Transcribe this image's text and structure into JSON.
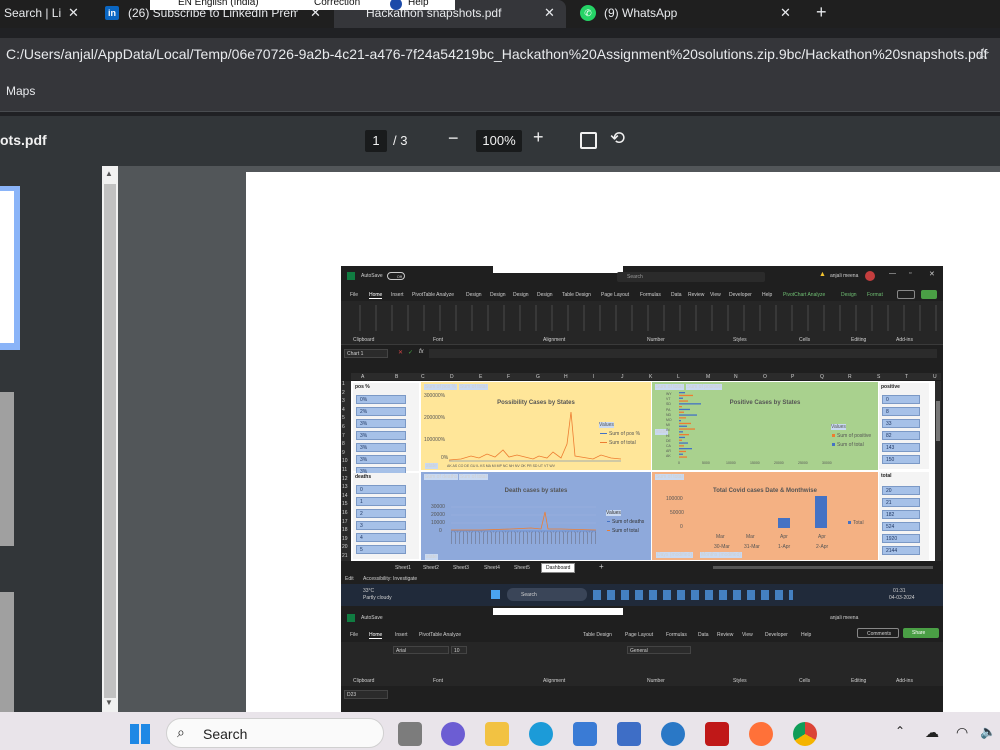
{
  "tabs": [
    {
      "label": "Search | Li",
      "active": false
    },
    {
      "label": "(26) Subscribe to LinkedIn Prem",
      "active": false
    },
    {
      "label": "Hackathon snapshots.pdf",
      "active": true
    },
    {
      "label": "(9) WhatsApp",
      "active": false
    }
  ],
  "lang_overlay": {
    "lang": "EN English (India)",
    "correction": "Correction",
    "help": "Help"
  },
  "address": {
    "url": "C:/Users/anjal/AppData/Local/Temp/06e70726-9a2b-4c21-a476-7f24a54219bc_Hackathon%20Assignment%20solutions.zip.9bc/Hackathon%20snapshots.pdf"
  },
  "bookmarks": {
    "item": "Maps"
  },
  "pdf": {
    "filename": "ots.pdf",
    "page": "1",
    "total": "/ 3",
    "zoom": "100%"
  },
  "excel": {
    "autosave": "AutoSave",
    "autosave_state": "Off",
    "search": "Search",
    "user": "anjali meena",
    "ribbon_tabs": [
      "File",
      "Home",
      "Insert",
      "PivotTable Analyze",
      "Design",
      "Design",
      "Design",
      "Design",
      "Table Design",
      "Page Layout",
      "Formulas",
      "Data",
      "Review",
      "View",
      "Developer",
      "Help",
      "PivotChart Analyze",
      "Design",
      "Format"
    ],
    "ribbon_groups": [
      "Clipboard",
      "Font",
      "Alignment",
      "Number",
      "Styles",
      "Cells",
      "Editing",
      "Add-ins"
    ],
    "name_box": "Chart 1",
    "columns": [
      "A",
      "B",
      "C",
      "D",
      "E",
      "F",
      "G",
      "H",
      "I",
      "J",
      "K",
      "L",
      "M",
      "N",
      "O",
      "P",
      "Q",
      "R",
      "S",
      "T",
      "U"
    ],
    "rows": [
      "1",
      "2",
      "3",
      "4",
      "5",
      "6",
      "7",
      "8",
      "9",
      "10",
      "11",
      "12",
      "13",
      "14",
      "15",
      "16",
      "17",
      "18",
      "19",
      "20",
      "21"
    ],
    "slicers": {
      "pos": {
        "title": "pos %",
        "items": [
          "0%",
          "2%",
          "3%",
          "3%",
          "3%",
          "3%",
          "3%"
        ]
      },
      "deaths": {
        "title": "deaths",
        "items": [
          "0",
          "1",
          "2",
          "3",
          "4",
          "5"
        ]
      },
      "positive": {
        "title": "positive",
        "items": [
          "0",
          "8",
          "33",
          "82",
          "143",
          "150"
        ]
      },
      "total": {
        "title": "total",
        "items": [
          "20",
          "21",
          "182",
          "524",
          "1920",
          "2144"
        ]
      }
    },
    "charts": {
      "c1": {
        "title": "Possibility Cases by States",
        "legend_title": "Values",
        "legend": [
          "Sum of pos %",
          "Sum of total"
        ],
        "btns": [
          "Sum of pos %",
          "Sum of total"
        ],
        "field": "state",
        "yticks": [
          "300000%",
          "200000%",
          "100000%",
          "0%"
        ],
        "xcats": "AK AS CO DE GU IL KS MA MI MP NC NH NV OK PR SD UT VT WV"
      },
      "c2": {
        "title": "Positive Cases by States",
        "legend_title": "Values",
        "legend": [
          "Sum of positive",
          "Sum of total"
        ],
        "btns": [
          "Sum of total",
          "Sum of positive"
        ],
        "field": "state",
        "xticks": [
          "0",
          "5000",
          "10000",
          "15000",
          "20000",
          "25000",
          "30000"
        ],
        "ycats": [
          "WY",
          "VT",
          "SD",
          "PA",
          "ND",
          "MO",
          "MI",
          "IN",
          "HI",
          "DE",
          "CA",
          "AR",
          "AK"
        ]
      },
      "c3": {
        "title": "Death cases by states",
        "legend_title": "Values",
        "legend": [
          "Sum of deaths",
          "Sum of total"
        ],
        "btns": [
          "Sum of deaths",
          "Sum of total"
        ],
        "field": "state",
        "yticks": [
          "30000",
          "20000",
          "10000",
          "0"
        ]
      },
      "c4": {
        "title": "Total Covid cases Date & Monthwise",
        "legend": [
          "Total"
        ],
        "btns": [
          "Sum of total"
        ],
        "fields": [
          "Days (modified)",
          "Months (modified)"
        ],
        "cats": [
          "Mar",
          "Mar",
          "Apr",
          "Apr"
        ],
        "subcats": [
          "30-Mar",
          "31-Mar",
          "1-Apr",
          "2-Apr"
        ],
        "yticks": [
          "100000",
          "50000",
          "0"
        ]
      }
    },
    "sheets": [
      "Sheet1",
      "Sheet2",
      "Sheet3",
      "Sheet4",
      "Sheet5",
      "Dashboard"
    ],
    "status": {
      "mode": "Edit",
      "access": "Accessibility: Investigate"
    },
    "weather": {
      "temp": "33°C",
      "cond": "Partly cloudy"
    },
    "clock": {
      "time": "01:31",
      "date": "04-03-2024"
    },
    "second": {
      "comments": "Comments",
      "share": "Share",
      "font": "Arial",
      "size": "10",
      "number": "General",
      "name_box": "D23"
    }
  },
  "taskbar": {
    "search": "Search"
  }
}
